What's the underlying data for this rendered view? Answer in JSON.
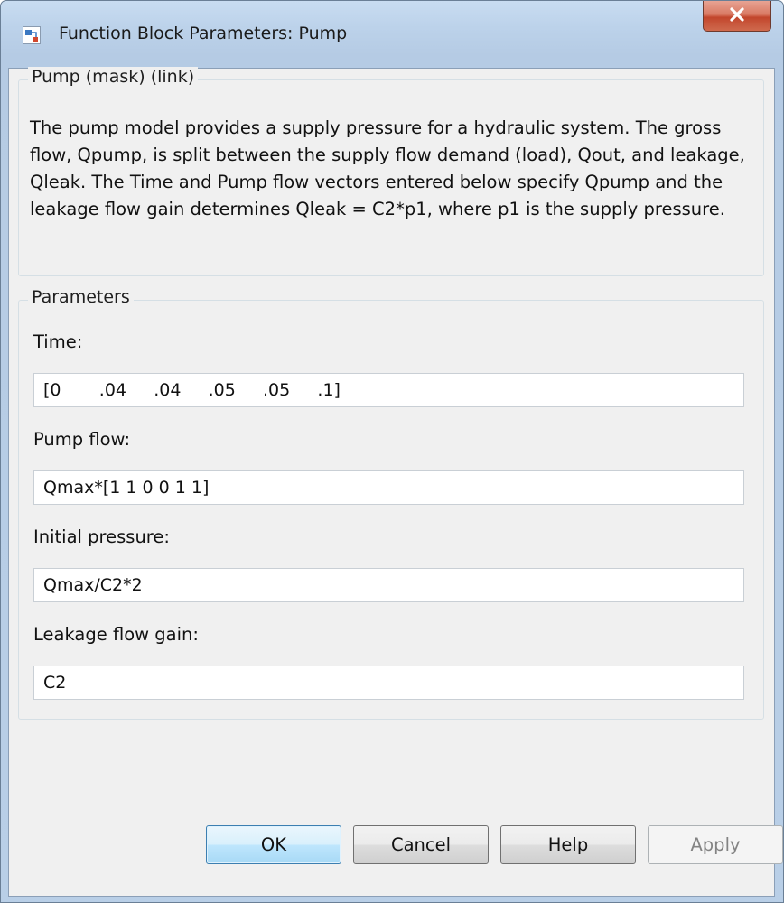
{
  "window": {
    "title": "Function Block Parameters: Pump",
    "icon": "simulink-block-icon",
    "close_icon": "close-icon",
    "close_color": "#c74a2f"
  },
  "description_group": {
    "legend": "Pump (mask) (link)",
    "text": "The pump model provides a supply pressure for a hydraulic system. The gross flow, Qpump, is split between the supply flow demand (load), Qout, and leakage, Qleak.  The Time and Pump flow vectors entered below specify Qpump and the leakage flow gain determines Qleak = C2*p1, where p1 is the supply pressure."
  },
  "parameters_group": {
    "legend": "Parameters",
    "fields": [
      {
        "label": "Time:",
        "value": "[0       .04     .04     .05     .05     .1]"
      },
      {
        "label": "Pump flow:",
        "value": "Qmax*[1 1 0 0 1 1]"
      },
      {
        "label": "Initial pressure:",
        "value": "Qmax/C2*2"
      },
      {
        "label": "Leakage flow gain:",
        "value": "C2"
      }
    ]
  },
  "buttons": {
    "ok": "OK",
    "cancel": "Cancel",
    "help": "Help",
    "apply": "Apply",
    "apply_enabled": false,
    "default_button": "ok"
  }
}
